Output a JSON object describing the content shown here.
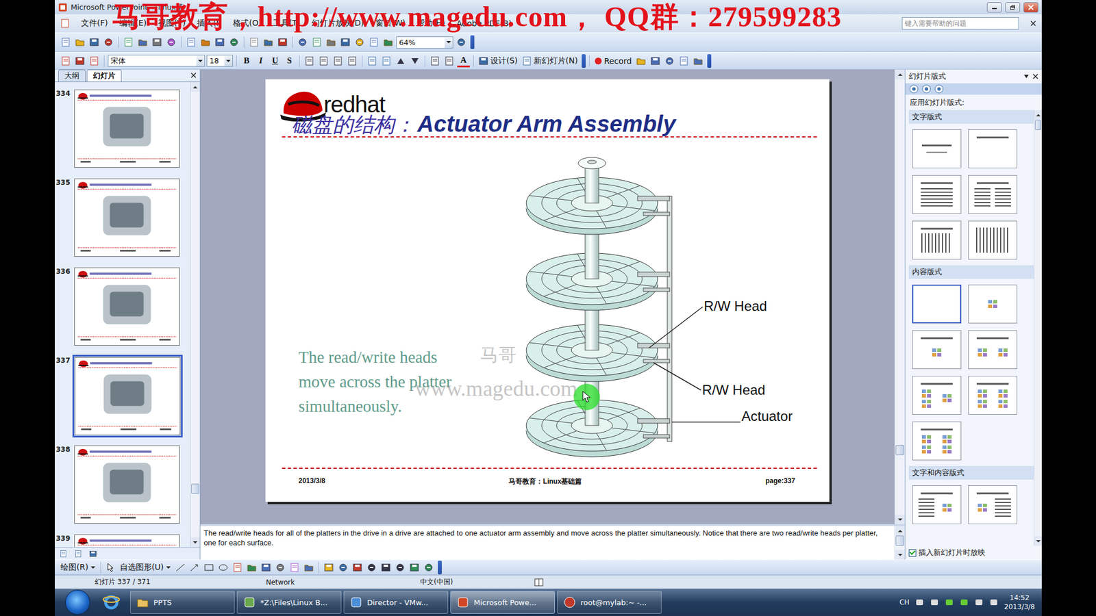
{
  "window": {
    "title": "Microsoft PowerPoint - [linux基"
  },
  "watermark": "马哥教育，http://www.magedu.com， QQ群：279599283",
  "menu": [
    "文件(F)",
    "编辑(E)",
    "视图(V)",
    "插入(I)",
    "格式(O)",
    "工具(T)",
    "幻灯片放映(D)",
    "窗口(W)",
    "帮助(H)",
    "Adobe PDF(B)"
  ],
  "help_box": {
    "placeholder": "键入需要帮助的问题"
  },
  "standard_toolbar": {
    "zoom": "64%"
  },
  "format_toolbar": {
    "font": "宋体",
    "size": "18",
    "styles": [
      "B",
      "I",
      "U",
      "S"
    ],
    "font_color": "A",
    "design": "设计(S)",
    "new_slide": "新幻灯片(N)",
    "record": "Record"
  },
  "panel_tabs": [
    {
      "label": "大纲",
      "selected": false
    },
    {
      "label": "幻灯片",
      "selected": true
    }
  ],
  "thumbnails": [
    {
      "number": "334",
      "selected": false
    },
    {
      "number": "335",
      "selected": false
    },
    {
      "number": "336",
      "selected": false
    },
    {
      "number": "337",
      "selected": true
    },
    {
      "number": "338",
      "selected": false
    },
    {
      "number": "339",
      "selected": false
    }
  ],
  "thumbnail_scroll": {
    "level": 0.9
  },
  "slide": {
    "logo": "redhat",
    "title_cn": "磁盘的结构：",
    "title_en": "Actuator Arm Assembly",
    "body": [
      "The read/write heads",
      "move across the platter",
      "simultaneously."
    ],
    "labels": [
      "R/W Head",
      "R/W Head",
      "Actuator"
    ],
    "watermark": [
      "马哥",
      "www.magedu.com"
    ],
    "footer": {
      "date": "2013/3/8",
      "center": "马哥教育：Linux基础篇",
      "page": "page:337"
    }
  },
  "slide_scroll": {
    "level": 0.86
  },
  "notes": "The read/write heads for all of the platters in the drive in a drive are attached to one actuator arm assembly and move across the platter simultaneously. Notice that there are two read/write heads per platter, one for each surface.",
  "task_pane": {
    "title": "幻灯片版式",
    "apply_label": "应用幻灯片版式:",
    "sections": [
      {
        "title": "文字版式",
        "layouts": [
          {
            "kind": "title-slide",
            "selected": false
          },
          {
            "kind": "title-only",
            "selected": false
          },
          {
            "kind": "title-text",
            "selected": false
          },
          {
            "kind": "two-text",
            "selected": false
          },
          {
            "kind": "vertical-text",
            "selected": false
          },
          {
            "kind": "vertical-title",
            "selected": false
          }
        ]
      },
      {
        "title": "内容版式",
        "layouts": [
          {
            "kind": "blank",
            "selected": true
          },
          {
            "kind": "content",
            "selected": false
          },
          {
            "kind": "title-content",
            "selected": false
          },
          {
            "kind": "title-two-content",
            "selected": false
          },
          {
            "kind": "title-three-content",
            "selected": false
          },
          {
            "kind": "title-four-content",
            "selected": false
          },
          {
            "kind": "title-four-content",
            "selected": false
          }
        ]
      },
      {
        "title": "文字和内容版式",
        "layouts": [
          {
            "kind": "text-content",
            "selected": false
          },
          {
            "kind": "content-text",
            "selected": false
          }
        ]
      }
    ],
    "show_on_insert": {
      "label": "插入新幻灯片时放映",
      "checked": true
    }
  },
  "drawing_toolbar": {
    "draw": "绘图(R)",
    "autoshapes": "自选图形(U)"
  },
  "status_bar": [
    "幻灯片 337 / 371",
    "Network",
    "中文(中国)"
  ],
  "taskbar": {
    "items": [
      {
        "label": "PPTS",
        "kind": "folder",
        "active": false
      },
      {
        "label": "*Z:\\Files\\Linux B...",
        "kind": "editor",
        "active": false
      },
      {
        "label": "Director - VMw...",
        "kind": "vmware",
        "active": false
      },
      {
        "label": "Microsoft Powe...",
        "kind": "powerpoint",
        "active": true
      },
      {
        "label": "root@mylab:~ -...",
        "kind": "terminal",
        "active": false
      }
    ],
    "tray": {
      "language": "CH",
      "time": "14:52",
      "date": "2013/3/8"
    }
  }
}
